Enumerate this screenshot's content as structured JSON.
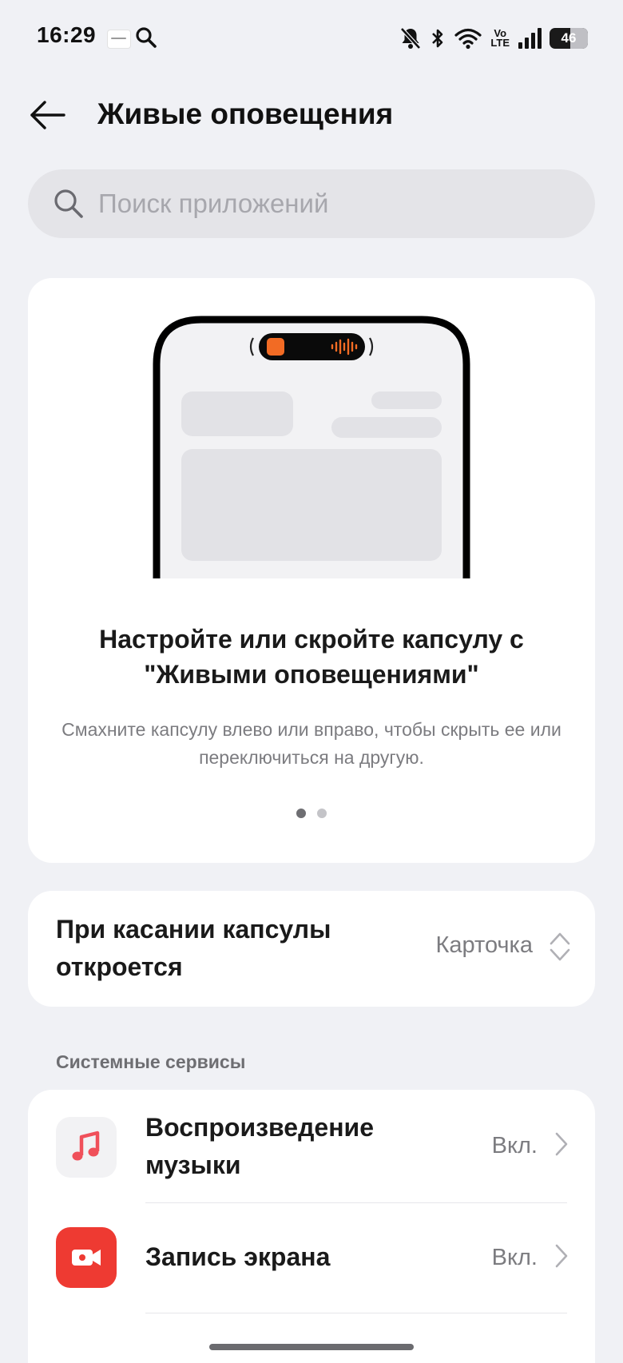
{
  "status_bar": {
    "time": "16:29",
    "volte_top": "Vo",
    "volte_bottom": "LTE",
    "battery_level": "46"
  },
  "header": {
    "title": "Живые оповещения"
  },
  "search": {
    "placeholder": "Поиск приложений",
    "value": ""
  },
  "hero": {
    "title": "Настройте или скройте капсулу с \"Живыми оповещениями\"",
    "subtitle": "Смахните капсулу влево или вправо, чтобы скрыть ее или переключиться на другую.",
    "pages_total": 2,
    "active_page": 1,
    "capsule_accent": "#f26b24"
  },
  "tap_setting": {
    "label": "При касании капсулы откроется",
    "value": "Карточка"
  },
  "system_services": {
    "header": "Системные сервисы",
    "items": [
      {
        "label": "Воспроизведение музыки",
        "status": "Вкл.",
        "icon": "music-note-icon",
        "icon_bg": "#f2f2f4",
        "icon_color": "#f0505a"
      },
      {
        "label": "Запись экрана",
        "status": "Вкл.",
        "icon": "video-record-icon",
        "icon_bg": "#ee3a32",
        "icon_color": "#ffffff"
      }
    ]
  },
  "colors": {
    "background": "#f0f1f5",
    "card": "#ffffff",
    "secondary_text": "#7c7c80"
  }
}
